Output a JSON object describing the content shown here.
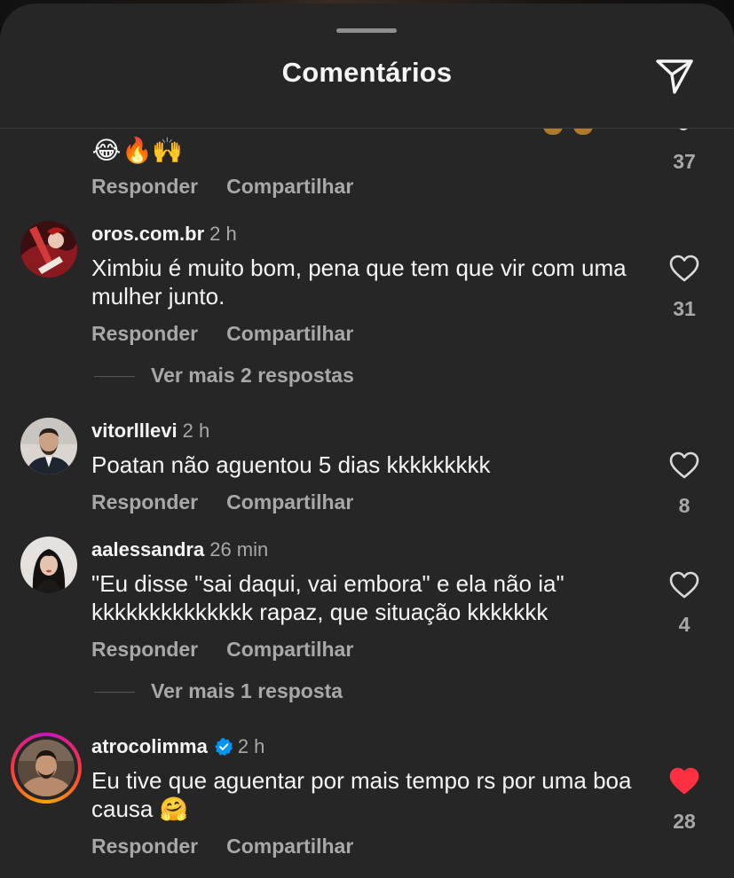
{
  "header": {
    "title": "Comentários"
  },
  "icons": {
    "share": "send-icon",
    "like": "heart-icon",
    "verified": "verified-badge-icon"
  },
  "colors": {
    "liked": "#ff3040",
    "verified": "#0095f6"
  },
  "previous_comment": {
    "emojis": [
      "😂",
      "🔥",
      "🙌"
    ],
    "likes": "37",
    "reply_label": "Responder",
    "share_label": "Compartilhar"
  },
  "comments": [
    {
      "username": "oros.com.br",
      "time": "2 h",
      "text": "Ximbiu é muito bom, pena que tem que vir com uma mulher junto.",
      "likes": "31",
      "liked": false,
      "reply_label": "Responder",
      "share_label": "Compartilhar",
      "more_replies": "Ver mais 2 respostas"
    },
    {
      "username": "vitorlllevi",
      "time": "2 h",
      "text": "Poatan não aguentou 5 dias kkkkkkkkk",
      "likes": "8",
      "liked": false,
      "reply_label": "Responder",
      "share_label": "Compartilhar"
    },
    {
      "username": "aalessandra",
      "time": "26 min",
      "text": "\"Eu disse \"sai daqui, vai embora\" e ela não ia\" kkkkkkkkkkkkkk rapaz, que situação kkkkkkk",
      "likes": "4",
      "liked": false,
      "reply_label": "Responder",
      "share_label": "Compartilhar",
      "more_replies": "Ver mais 1 resposta"
    },
    {
      "username": "atrocolimma",
      "verified": true,
      "time": "2 h",
      "text": "Eu tive que aguentar por mais tempo rs por uma boa causa 🤗",
      "likes": "28",
      "liked": true,
      "reply_label": "Responder",
      "share_label": "Compartilhar"
    }
  ]
}
